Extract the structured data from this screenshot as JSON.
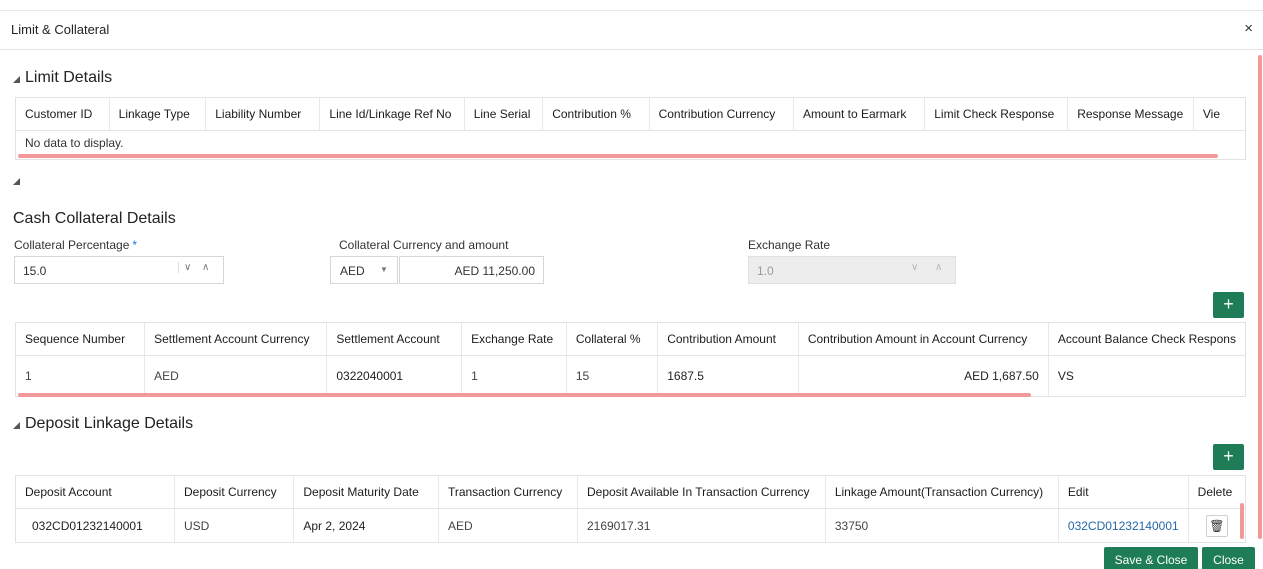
{
  "window": {
    "title": "Limit & Collateral",
    "close_glyph": "×"
  },
  "limit_details": {
    "heading": "Limit Details",
    "columns": [
      "Customer ID",
      "Linkage Type",
      "Liability Number",
      "Line Id/Linkage Ref No",
      "Line Serial",
      "Contribution %",
      "Contribution Currency",
      "Amount to Earmark",
      "Limit Check Response",
      "Response Message",
      "Vie"
    ],
    "empty_text": "No data to display."
  },
  "cash_collateral": {
    "heading": "Cash Collateral Details",
    "collateral_percentage": {
      "label": "Collateral Percentage",
      "required_mark": "*",
      "value": "15.0"
    },
    "collateral_currency_amount": {
      "label": "Collateral Currency and amount",
      "currency": "AED",
      "amount": "AED 11,250.00"
    },
    "exchange_rate": {
      "label": "Exchange Rate",
      "value": "1.0"
    },
    "add_label": "+",
    "columns": [
      "Sequence Number",
      "Settlement Account Currency",
      "Settlement Account",
      "Exchange Rate",
      "Collateral %",
      "Contribution Amount",
      "Contribution Amount in Account Currency",
      "Account Balance Check Respons"
    ],
    "rows": [
      [
        "1",
        "AED",
        "0322040001",
        "1",
        "15",
        "1687.5",
        "AED 1,687.50",
        "VS"
      ]
    ]
  },
  "deposit_linkage": {
    "heading": "Deposit Linkage Details",
    "add_label": "+",
    "columns": [
      "Deposit Account",
      "Deposit Currency",
      "Deposit Maturity Date",
      "Transaction Currency",
      "Deposit Available In Transaction Currency",
      "Linkage Amount(Transaction Currency)",
      "Edit",
      "Delete"
    ],
    "rows": [
      [
        "032CD01232140001",
        "USD",
        "Apr 2, 2024",
        "AED",
        "2169017.31",
        "33750",
        "032CD01232140001",
        "trash-icon"
      ]
    ]
  },
  "footer": {
    "save_close": "Save & Close",
    "close": "Close"
  },
  "colors": {
    "accent": "#1e7c57",
    "scrollbar": "#f2999a",
    "link": "#2468a8"
  }
}
